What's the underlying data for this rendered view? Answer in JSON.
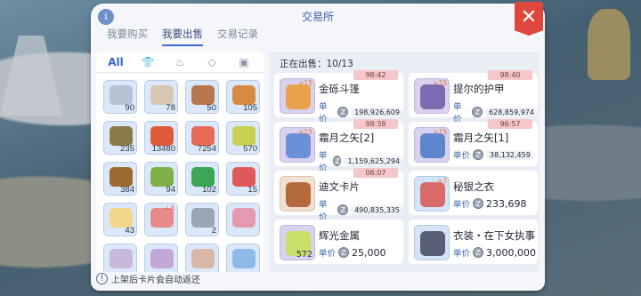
{
  "window": {
    "title": "交易所",
    "close_label": "✕",
    "info_label": "i",
    "tabs": [
      {
        "label": "我要购买",
        "active": false
      },
      {
        "label": "我要出售",
        "active": true
      },
      {
        "label": "交易记录",
        "active": false
      }
    ]
  },
  "inventory": {
    "categories": [
      {
        "label": "All",
        "active": true
      },
      {
        "icon": "shirt-icon",
        "label": "👕"
      },
      {
        "icon": "gourd-icon",
        "label": "♨"
      },
      {
        "icon": "diamond-icon",
        "label": "◇"
      },
      {
        "icon": "card-icon",
        "label": "▣"
      }
    ],
    "slots": [
      {
        "qty": "90",
        "color": "#b7c3d4"
      },
      {
        "qty": "78",
        "color": "#d8c7b0"
      },
      {
        "qty": "50",
        "color": "#b9754e"
      },
      {
        "qty": "105",
        "color": "#d88a43"
      },
      {
        "qty": "235",
        "color": "#8c7b4a"
      },
      {
        "qty": "13480",
        "color": "#e2583a"
      },
      {
        "qty": "7254",
        "color": "#e86b5a"
      },
      {
        "qty": "570",
        "color": "#c9d155"
      },
      {
        "qty": "384",
        "color": "#9c6a2e"
      },
      {
        "qty": "94",
        "color": "#7fb04a"
      },
      {
        "qty": "102",
        "color": "#3aa656"
      },
      {
        "qty": "15",
        "color": "#e0595a"
      },
      {
        "qty": "43",
        "color": "#f1d68c"
      },
      {
        "qty": "",
        "plus": "+4",
        "color": "#e78a8a"
      },
      {
        "qty": "2",
        "color": "#9aa6b8"
      },
      {
        "qty": "",
        "color": "#e59ab0"
      },
      {
        "qty": "",
        "color": "#c7b9da"
      },
      {
        "qty": "",
        "color": "#c3a7d6"
      },
      {
        "qty": "",
        "color": "#d9b7a6"
      },
      {
        "qty": "",
        "color": "#8fb9e8"
      }
    ],
    "footnote": "上架后卡片会自动返还"
  },
  "selling": {
    "status": "正在出售：10/13",
    "price_label": "单价",
    "coin_label": "Z",
    "items": [
      {
        "timer": "98:42",
        "name": "金砾斗篷",
        "price": "198,926,609",
        "big": false,
        "level": "+15",
        "thumb": "purple",
        "color": "#e8a24c"
      },
      {
        "timer": "98:40",
        "name": "提尔的护甲",
        "price": "628,859,974",
        "big": false,
        "level": "+15",
        "thumb": "purple",
        "color": "#7d6ab0"
      },
      {
        "timer": "98:38",
        "name": "霜月之矢[2]",
        "price": "1,159,625,294",
        "big": false,
        "level": "+15",
        "thumb": "purple",
        "color": "#6b8fd8"
      },
      {
        "timer": "96:57",
        "name": "霜月之矢[1]",
        "price": "38,132,459",
        "big": false,
        "level": "+15",
        "thumb": "purple",
        "color": "#5e86cf"
      },
      {
        "timer": "06:07",
        "name": "迪文卡片",
        "price": "490,835,335",
        "big": false,
        "level": "",
        "thumb": "brown",
        "color": "#b46a3c"
      },
      {
        "timer": "",
        "name": "秘银之衣",
        "price": "233,698",
        "big": true,
        "level": "+3",
        "thumb": "blue",
        "color": "#d86a6a"
      },
      {
        "timer": "",
        "name": "辉光金属",
        "price": "25,000",
        "big": true,
        "level": "",
        "qty": "572",
        "thumb": "purple",
        "color": "#c7e06a"
      },
      {
        "timer": "",
        "name": "衣装・在下女执事",
        "price": "3,000,000",
        "big": true,
        "level": "",
        "thumb": "blue",
        "color": "#596075"
      }
    ]
  }
}
